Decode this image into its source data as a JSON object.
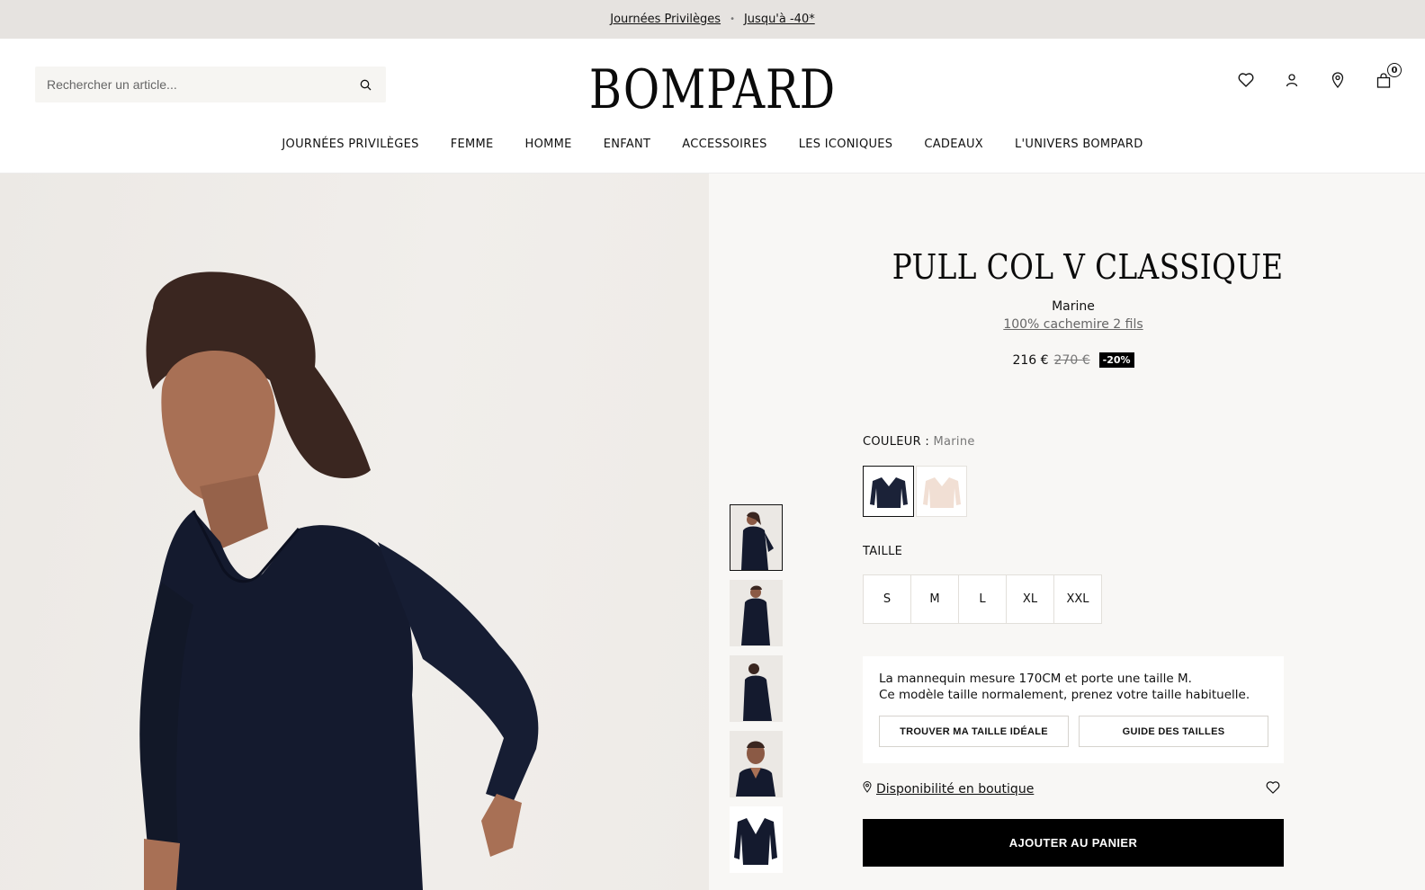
{
  "promo": {
    "link1": "Journées Privilèges",
    "separator": "•",
    "link2": "Jusqu'à -40*"
  },
  "header": {
    "search_placeholder": "Rechercher un article...",
    "logo": "BOMPARD",
    "cart_count": "0",
    "icons": [
      "heart-icon",
      "user-icon",
      "location-icon",
      "bag-icon"
    ]
  },
  "nav": {
    "items": [
      "JOURNÉES PRIVILÈGES",
      "FEMME",
      "HOMME",
      "ENFANT",
      "ACCESSOIRES",
      "LES ICONIQUES",
      "CADEAUX",
      "L'UNIVERS BOMPARD"
    ]
  },
  "product": {
    "title": "PULL COL V CLASSIQUE",
    "color_name": "Marine",
    "composition": "100% cachemire 2 fils",
    "price": "216 €",
    "old_price": "270 €",
    "discount": "-20%",
    "color_label": "COULEUR :",
    "color_value": "Marine",
    "swatch_colors": [
      "#1b2238",
      "#f1dfd4"
    ],
    "size_label": "TAILLE",
    "sizes": [
      "S",
      "M",
      "L",
      "XL",
      "XXL"
    ],
    "fit_line1": "La mannequin mesure 170CM et porte une taille M.",
    "fit_line2": "Ce modèle taille normalement, prenez votre taille habituelle.",
    "fit_button1": "TROUVER MA TAILLE IDÉALE",
    "fit_button2": "GUIDE DES TAILLES",
    "availability": "Disponibilité en boutique",
    "add_to_cart": "AJOUTER AU PANIER"
  },
  "colors": {
    "promo_bg": "#e6e3e0",
    "panel_bg": "#f8f7f5",
    "sweater": "#141a2e",
    "button_bg": "#000000"
  }
}
